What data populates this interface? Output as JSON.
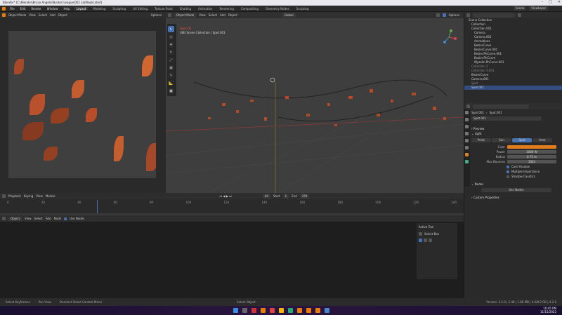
{
  "titlebar": {
    "title": "Blender* [C:\\Blender\\Bruce Angelis\\Bucket League\\001 Lib\\Replicated]"
  },
  "topbar": {
    "menus": [
      "File",
      "Edit",
      "Render",
      "Window",
      "Help"
    ],
    "workspaces": [
      "Layout",
      "Modeling",
      "Sculpting",
      "UV Editing",
      "Texture Paint",
      "Shading",
      "Animation",
      "Rendering",
      "Compositing",
      "Geometry Nodes",
      "Scripting"
    ],
    "scene": "Scene",
    "view_layer": "ViewLayer"
  },
  "left_view": {
    "mode": "Object Mode",
    "menus": [
      "View",
      "Select",
      "Add",
      "Object"
    ],
    "options": "Options"
  },
  "viewport": {
    "mode": "Object Mode",
    "menus": [
      "View",
      "Select",
      "Add",
      "Object"
    ],
    "transform": "Global",
    "options": "Options",
    "info_line1": "Spot (X)",
    "info_line2": "(48) Scene Collection | Spot.001"
  },
  "timeline": {
    "menus": [
      "Playback",
      "Keying",
      "View",
      "Marker"
    ],
    "current_frame": "40",
    "start_label": "Start",
    "start": "1",
    "end_label": "End",
    "end": "250",
    "ticks": [
      "0",
      "20",
      "40",
      "60",
      "80",
      "100",
      "120",
      "140",
      "160",
      "180",
      "200",
      "220",
      "240"
    ]
  },
  "node_editor": {
    "type": "Object",
    "menus": [
      "View",
      "Select",
      "Add",
      "Node"
    ],
    "use_nodes": "Use Nodes",
    "panel_title": "Active Tool",
    "panel_item": "Select Box"
  },
  "outliner": {
    "title": "Scene Collection",
    "items": [
      "Collection",
      "Collection.001",
      "Camera",
      "Camera.001",
      "Animations",
      "BezierCurve",
      "BezierCurve.001",
      "Bezier.PhCurve.001",
      "Bezier.PhCurve",
      "Wyzelin.PhCurve.001",
      "Collection 2",
      "Collection 3.001",
      "BezierCurve",
      "Camera.001",
      "Spot",
      "Spot.001"
    ]
  },
  "properties": {
    "object": "Spot.001",
    "data": "Spot.001",
    "data_field": "Spot.001",
    "sections": [
      "Preview",
      "Light"
    ],
    "light_types": [
      "Point",
      "Sun",
      "Spot",
      "Area"
    ],
    "active_type": "Spot",
    "color_label": "Color",
    "color": "#e07b1e",
    "power_label": "Power",
    "power": "1000 W",
    "radius_label": "Radius",
    "radius": "0.75 m",
    "max_bounces_label": "Max Bounces",
    "max_bounces": "1024",
    "cast_shadow": "Cast Shadow",
    "multiple_importance": "Multiple Importance",
    "shadow_caustics": "Shadow Caustics",
    "nodes_section": "Nodes",
    "use_nodes_btn": "Use Nodes",
    "custom_props": "Custom Properties"
  },
  "status": {
    "items": [
      "Select Keyframes",
      "Pan View",
      "Deselect Select Context Menu",
      "Select Object"
    ],
    "version": "Version: 3.2.0 | 2.48 | 1.88 MB | 4.6/8.0 GB | 4.2.0"
  },
  "taskbar": {
    "time": "10:45 PM",
    "date": "11/15/2022"
  },
  "colors": {
    "accent": "#4772b3",
    "leaf": "#c6542a"
  }
}
